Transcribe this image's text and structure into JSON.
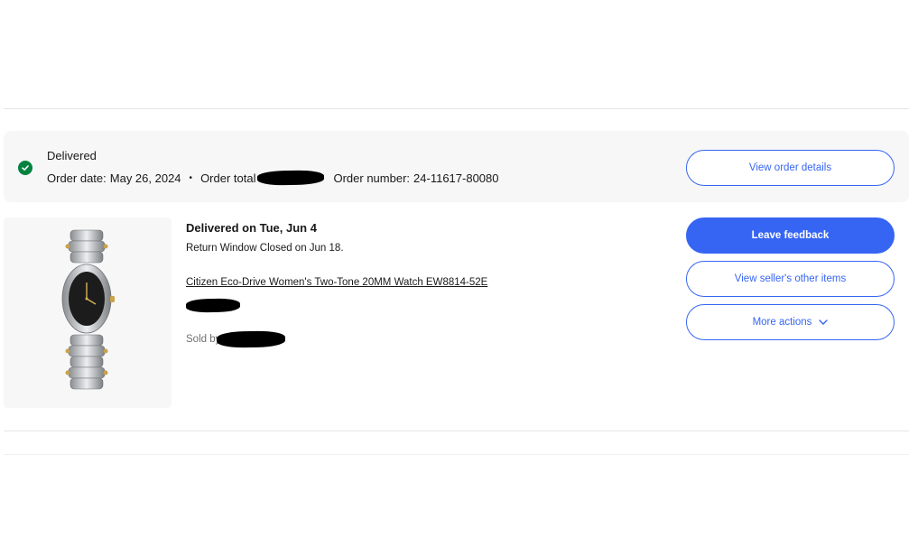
{
  "order": {
    "status_label": "Delivered",
    "order_date_label": "Order date:",
    "order_date": "May 26, 2024",
    "separator": "•",
    "order_total_label": "Order total",
    "order_number_label": "Order number:",
    "order_number": "24-11617-80080",
    "view_details_label": "View order details",
    "status_icon": "check-circle-icon",
    "status_color": "#05823f"
  },
  "item": {
    "delivery_status": "Delivered on Tue, Jun 4",
    "return_window": "Return Window Closed on Jun 18.",
    "title": "Citizen Eco-Drive Women's Two-Tone 20MM Watch EW8814-52E",
    "sold_by_label": "Sold by"
  },
  "actions": {
    "leave_feedback": "Leave feedback",
    "view_seller_items": "View seller's other items",
    "more_actions": "More actions",
    "more_actions_icon": "chevron-down-icon"
  },
  "colors": {
    "accent": "#3665f3",
    "panel_bg": "#f7f7f7",
    "muted_text": "#707070"
  }
}
